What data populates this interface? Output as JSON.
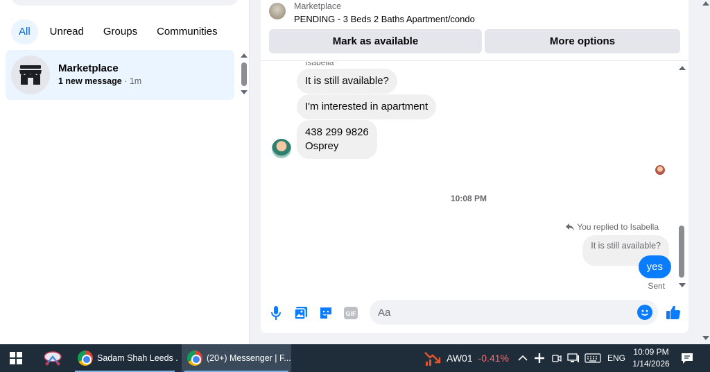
{
  "sidebar": {
    "filters": [
      {
        "label": "All",
        "active": true
      },
      {
        "label": "Unread",
        "active": false
      },
      {
        "label": "Groups",
        "active": false
      },
      {
        "label": "Communities",
        "active": false
      }
    ],
    "conversation": {
      "name": "Marketplace",
      "preview": "1 new message",
      "time": "· 1m",
      "icon": "storefront-icon"
    }
  },
  "chat": {
    "listing": {
      "source": "Marketplace",
      "title": "PENDING - 3 Beds 2 Baths Apartment/condo",
      "primary_button": "Mark as available",
      "secondary_button": "More options"
    },
    "sender_name": "Isabella",
    "incoming_messages": [
      "It is still available?",
      "I'm interested in apartment",
      "438 299 9826\nOsprey"
    ],
    "timestamp": "10:08 PM",
    "reply_header": "You replied to Isabella",
    "quoted_text": "It is still available?",
    "outgoing_message": "yes",
    "delivery_status": "Sent",
    "composer": {
      "placeholder": "Aa",
      "icons": [
        "microphone-icon",
        "photo-icon",
        "sticker-icon",
        "gif-icon",
        "emoji-icon",
        "thumbs-up-icon"
      ],
      "gif_label": "GIF"
    },
    "accent_color": "#0a7cff"
  },
  "taskbar": {
    "apps": [
      {
        "label": "Sadam Shah Leeds ...",
        "active": false
      },
      {
        "label": "(20+) Messenger | F...",
        "active": true
      }
    ],
    "stock": {
      "symbol": "AW01",
      "change": "-0.41%"
    },
    "language": "ENG",
    "time": "10:09 PM",
    "date": "1/14/2026"
  }
}
